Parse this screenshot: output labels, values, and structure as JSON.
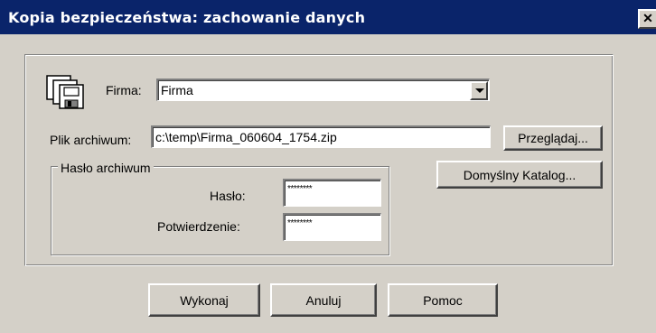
{
  "window": {
    "title": "Kopia bezpieczeństwa: zachowanie danych",
    "close_label": "✕"
  },
  "firma": {
    "label": "Firma:",
    "value": "Firma",
    "icon": "floppy-disks-icon"
  },
  "archive": {
    "label": "Plik archiwum:",
    "value": "c:\\temp\\Firma_060604_1754.zip",
    "browse_label": "Przeglądaj...",
    "default_dir_label": "Domyślny Katalog..."
  },
  "password_group": {
    "legend": "Hasło archiwum",
    "password_label": "Hasło:",
    "password_value": "********",
    "confirm_label": "Potwierdzenie:",
    "confirm_value": "********"
  },
  "buttons": {
    "execute": "Wykonaj",
    "cancel": "Anuluj",
    "help": "Pomoc"
  }
}
